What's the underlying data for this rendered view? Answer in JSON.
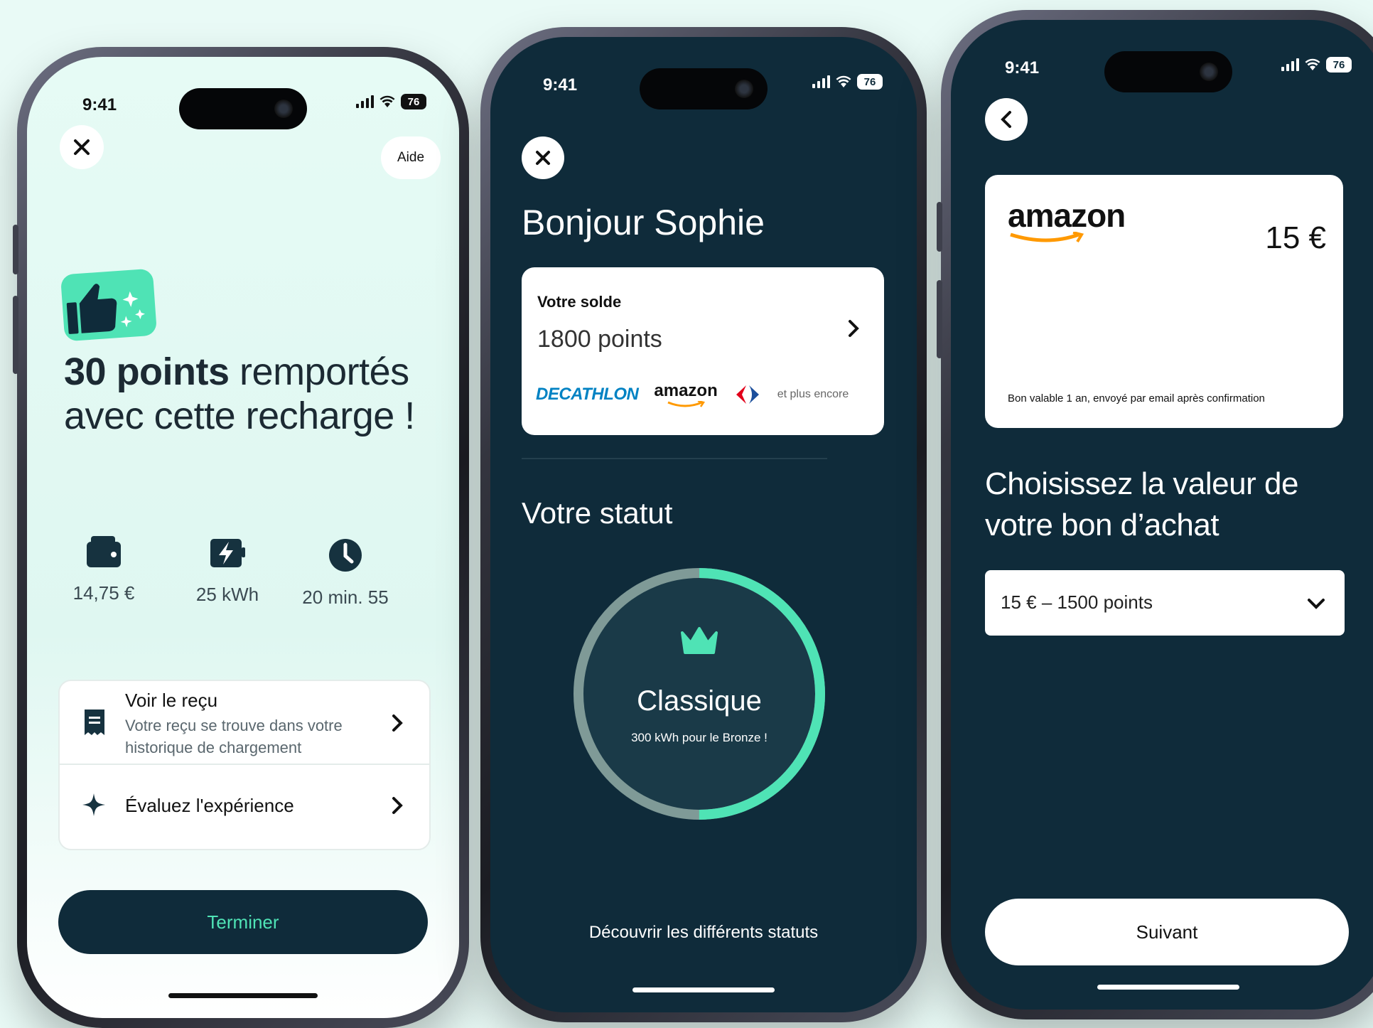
{
  "colors": {
    "accent": "#4fe3b5",
    "dark": "#0f2b3a",
    "light_bg": "#e6fbf5"
  },
  "phone1": {
    "status": {
      "time": "9:41",
      "battery": "76"
    },
    "help_label": "Aide",
    "headline_bold": "30 points",
    "headline_rest": " remportés avec cette recharge !",
    "stats": [
      {
        "icon": "wallet-icon",
        "value": "14,75 €"
      },
      {
        "icon": "charging-icon",
        "value": "25 kWh"
      },
      {
        "icon": "clock-icon",
        "value": "20 min. 55"
      }
    ],
    "receipt": {
      "title": "Voir le reçu",
      "subtitle": "Votre reçu se trouve dans votre historique de chargement"
    },
    "rate": {
      "title": "Évaluez l'expérience"
    },
    "finish_label": "Terminer"
  },
  "phone2": {
    "status": {
      "time": "9:41",
      "battery": "76"
    },
    "greeting": "Bonjour Sophie",
    "balance": {
      "label": "Votre solde",
      "value": "1800 points"
    },
    "brands": {
      "decathlon": "DECATHLON",
      "amazon": "amazon",
      "more": "et plus encore"
    },
    "status_title": "Votre statut",
    "tier": {
      "name": "Classique",
      "next": "300 kWh pour le Bronze !",
      "progress": 0.5
    },
    "discover_label": "Découvrir les différents statuts"
  },
  "phone3": {
    "status": {
      "time": "9:41",
      "battery": "76"
    },
    "voucher": {
      "brand": "amazon",
      "amount": "15 €",
      "note": "Bon valable 1 an, envoyé par email après confirmation"
    },
    "choose_title": "Choisissez la valeur de votre bon d’achat",
    "select_value": "15 € – 1500 points",
    "next_label": "Suivant"
  }
}
